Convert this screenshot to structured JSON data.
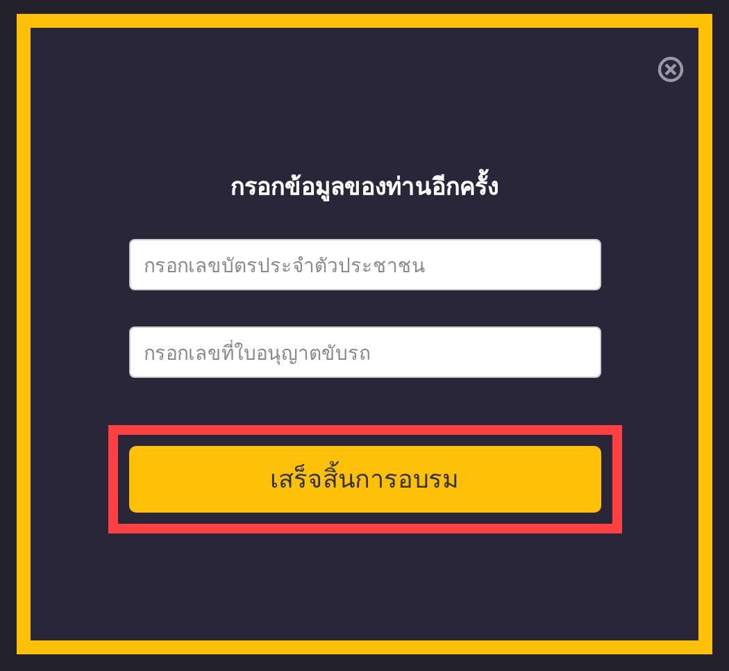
{
  "dialog": {
    "title": "กรอกข้อมูลของท่านอีกครั้ง",
    "fields": [
      {
        "placeholder": "กรอกเลขบัตรประจำตัวประชาชน"
      },
      {
        "placeholder": "กรอกเลขที่ใบอนุญาตขับรถ"
      }
    ],
    "submit": {
      "label": "เสร็จสิ้นการอบรม",
      "highlighted": true
    }
  }
}
